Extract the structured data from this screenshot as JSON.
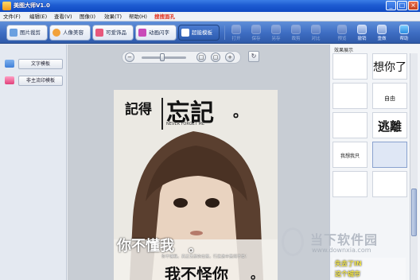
{
  "app": {
    "title": "美图大师V1.0"
  },
  "window_buttons": [
    "_",
    "□",
    "×"
  ],
  "menu": {
    "items": [
      "文件(F)",
      "编辑(E)",
      "查看(V)",
      "图像(I)",
      "效果(T)",
      "帮助(H)"
    ],
    "highlight": "搜搜面孔"
  },
  "tabs": [
    {
      "label": "图片裁剪",
      "color": "#6aa0e0"
    },
    {
      "label": "人像美容",
      "color": "#f2a23a"
    },
    {
      "label": "可爱饰品",
      "color": "#e8587c"
    },
    {
      "label": "动画闪字",
      "color": "#c94ab8"
    },
    {
      "label": "超能模板",
      "color": "#ffffff"
    }
  ],
  "toolbar_buttons": [
    {
      "label": "打开",
      "enabled": false
    },
    {
      "label": "保存",
      "enabled": false
    },
    {
      "label": "另存",
      "enabled": false
    },
    {
      "label": "裁剪",
      "enabled": false
    },
    {
      "label": "对比",
      "enabled": false
    },
    {
      "label": "预览",
      "enabled": false
    },
    {
      "label": "撤销",
      "enabled": true
    },
    {
      "label": "重做",
      "enabled": true
    },
    {
      "label": "帮助",
      "enabled": true
    }
  ],
  "left_panel": {
    "items": [
      {
        "label": "文字模板",
        "icon": "text-template-icon"
      },
      {
        "label": "非主流印模板",
        "icon": "stamp-template-icon"
      }
    ]
  },
  "zoom": {
    "level": 0.45
  },
  "photo": {
    "headline_left": "記得",
    "headline_right": "忘記",
    "headline_dot": "。",
    "small_text": "NEVER FORGET ME",
    "bottom_line1": "你不懂我",
    "bottom_line1_dot": "。",
    "bottom_small": "你不懂我，真正无奈的出离，行走途中苦闷不安！",
    "bottom_line2": "我不怪你",
    "bottom_line2_dot": "。"
  },
  "right_panel": {
    "header": "效果展示",
    "thumbs": [
      {
        "text": "",
        "selected": false
      },
      {
        "text": "想你了",
        "selected": false
      },
      {
        "text": "",
        "selected": false
      },
      {
        "text": "自由",
        "selected": false
      },
      {
        "text": "",
        "selected": false
      },
      {
        "text": "逃離",
        "selected": false
      },
      {
        "text": "我想我只",
        "selected": false
      },
      {
        "text": "",
        "selected": true
      },
      {
        "text": "",
        "selected": false
      },
      {
        "text": "",
        "selected": false
      }
    ]
  },
  "watermark": {
    "brand": "当下软件园",
    "url": "www.downxia.com"
  },
  "tooltip": {
    "line1": "失去了IN",
    "line2": "这个城市"
  }
}
